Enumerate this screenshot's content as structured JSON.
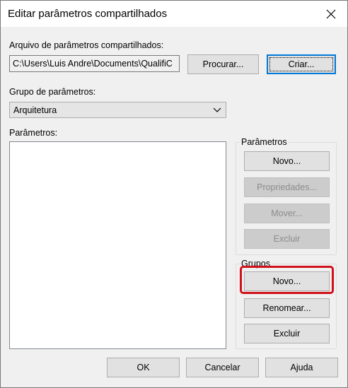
{
  "window": {
    "title": "Editar parâmetros compartilhados",
    "close_icon": "close-icon"
  },
  "file": {
    "label": "Arquivo de parâmetros compartilhados:",
    "path": "C:\\Users\\Luis Andre\\Documents\\QualifiC",
    "browse_label": "Procurar...",
    "create_label": "Criar..."
  },
  "group_select": {
    "label": "Grupo de parâmetros:",
    "selected": "Arquitetura"
  },
  "parameters_list": {
    "label": "Parâmetros:",
    "items": []
  },
  "parameters_box": {
    "title": "Parâmetros",
    "new_label": "Novo...",
    "properties_label": "Propriedades...",
    "move_label": "Mover...",
    "delete_label": "Excluir"
  },
  "groups_box": {
    "title": "Grupos",
    "new_label": "Novo...",
    "rename_label": "Renomear...",
    "delete_label": "Excluir"
  },
  "footer": {
    "ok_label": "OK",
    "cancel_label": "Cancelar",
    "help_label": "Ajuda"
  },
  "colors": {
    "highlight": "#d0121b",
    "focus_border": "#0078d7"
  }
}
